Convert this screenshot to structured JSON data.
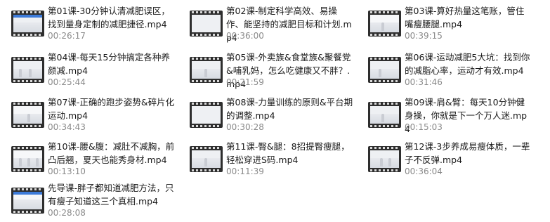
{
  "files": [
    {
      "title": "第01课-30分钟认清减肥误区，找到量身定制的减肥捷径.mp4",
      "duration": "00:26:17"
    },
    {
      "title": "第02课-制定科学高效、易操作、能坚持的减肥目标和计划.mp4",
      "duration": "00:36:00"
    },
    {
      "title": "第03课-算好热量这笔账，管住嘴瘦腰腿.mp4",
      "duration": "00:39:15"
    },
    {
      "title": "第04课-每天15分钟搞定各种养颜减.mp4",
      "duration": "00:25:44"
    },
    {
      "title": "第05课-外卖族&食堂族&聚餐党&哺乳妈，怎么吃健康又不胖？.mp4",
      "duration": "00:21:59"
    },
    {
      "title": "第06课-运动减肥5大坑：找到你的减脂心率，运动才有效.mp4",
      "duration": "00:31:46"
    },
    {
      "title": "第07课-正确的跑步姿势&碎片化运动.mp4",
      "duration": "00:34:43"
    },
    {
      "title": "第08课-力量训练的原则&平台期的调整.mp4",
      "duration": "00:30:28"
    },
    {
      "title": "第09课-肩&臂：每天10分钟健身操，你就是下一个万人迷.mp4",
      "duration": "00:15:03"
    },
    {
      "title": "第10课-腰&腹：减肚不减胸，前凸后翘，夏天也能秀身材.mp4",
      "duration": "00:13:10"
    },
    {
      "title": "第11课-臀&腿：8招提臀瘦腿，轻松穿进S码.mp4",
      "duration": "00:11:39"
    },
    {
      "title": "第12课-3步养成易瘦体质，一辈子不反弹.mp4",
      "duration": "00:36:04"
    },
    {
      "title": "先导课-胖子都知道减肥方法，只有瘦子知道这三个真相.mp4",
      "duration": "00:28:08"
    }
  ]
}
